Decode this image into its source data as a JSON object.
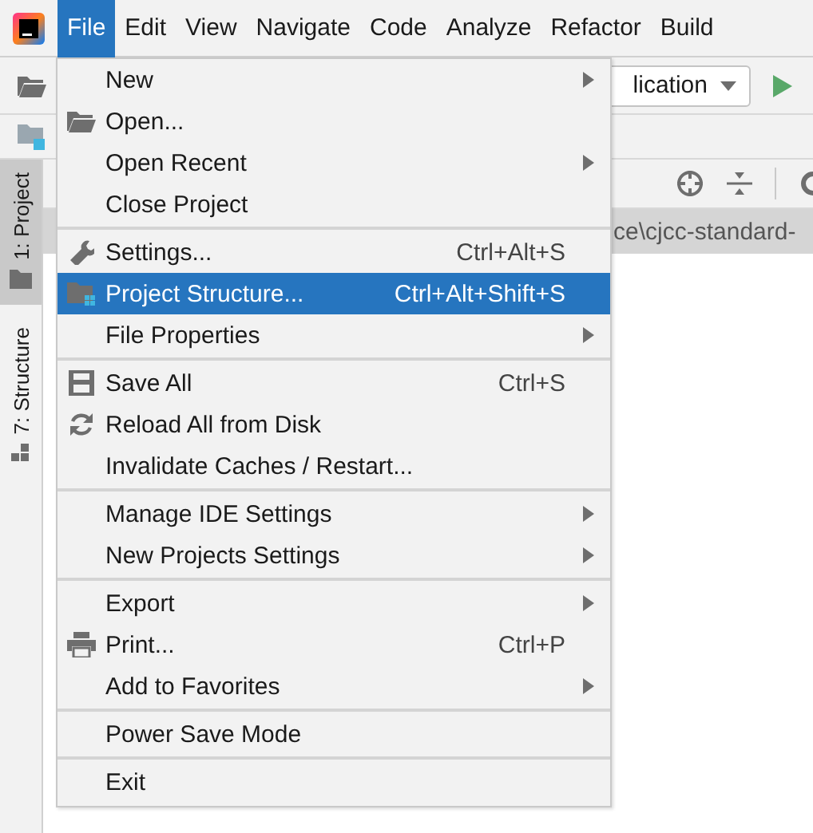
{
  "menubar": [
    {
      "label": "File",
      "selected": true
    },
    {
      "label": "Edit",
      "selected": false
    },
    {
      "label": "View",
      "selected": false
    },
    {
      "label": "Navigate",
      "selected": false
    },
    {
      "label": "Code",
      "selected": false
    },
    {
      "label": "Analyze",
      "selected": false
    },
    {
      "label": "Refactor",
      "selected": false
    },
    {
      "label": "Build",
      "selected": false
    }
  ],
  "toolbar": {
    "run_config": "lication"
  },
  "tool_strip": [
    {
      "label": "1: Project",
      "selected": true
    },
    {
      "label": "7: Structure",
      "selected": false
    }
  ],
  "path_bar": "ce\\cjcc-standard-",
  "file_menu": [
    {
      "kind": "item",
      "label": "New",
      "submenu": true,
      "selected": false
    },
    {
      "kind": "item",
      "label": "Open...",
      "submenu": false,
      "selected": false
    },
    {
      "kind": "item",
      "label": "Open Recent",
      "submenu": true,
      "selected": false
    },
    {
      "kind": "item",
      "label": "Close Project",
      "submenu": false,
      "selected": false
    },
    {
      "kind": "separator"
    },
    {
      "kind": "item",
      "label": "Settings...",
      "shortcut": "Ctrl+Alt+S",
      "submenu": false,
      "selected": false
    },
    {
      "kind": "item",
      "label": "Project Structure...",
      "shortcut": "Ctrl+Alt+Shift+S",
      "submenu": false,
      "selected": true
    },
    {
      "kind": "item",
      "label": "File Properties",
      "submenu": true,
      "selected": false
    },
    {
      "kind": "separator"
    },
    {
      "kind": "item",
      "label": "Save All",
      "shortcut": "Ctrl+S",
      "submenu": false,
      "selected": false
    },
    {
      "kind": "item",
      "label": "Reload All from Disk",
      "submenu": false,
      "selected": false
    },
    {
      "kind": "item",
      "label": "Invalidate Caches / Restart...",
      "submenu": false,
      "selected": false
    },
    {
      "kind": "separator"
    },
    {
      "kind": "item",
      "label": "Manage IDE Settings",
      "submenu": true,
      "selected": false
    },
    {
      "kind": "item",
      "label": "New Projects Settings",
      "submenu": true,
      "selected": false
    },
    {
      "kind": "separator"
    },
    {
      "kind": "item",
      "label": "Export",
      "submenu": true,
      "selected": false
    },
    {
      "kind": "item",
      "label": "Print...",
      "shortcut": "Ctrl+P",
      "submenu": false,
      "selected": false
    },
    {
      "kind": "item",
      "label": "Add to Favorites",
      "submenu": true,
      "selected": false
    },
    {
      "kind": "separator"
    },
    {
      "kind": "item",
      "label": "Power Save Mode",
      "submenu": false,
      "selected": false
    },
    {
      "kind": "separator"
    },
    {
      "kind": "item",
      "label": "Exit",
      "submenu": false,
      "selected": false
    }
  ]
}
